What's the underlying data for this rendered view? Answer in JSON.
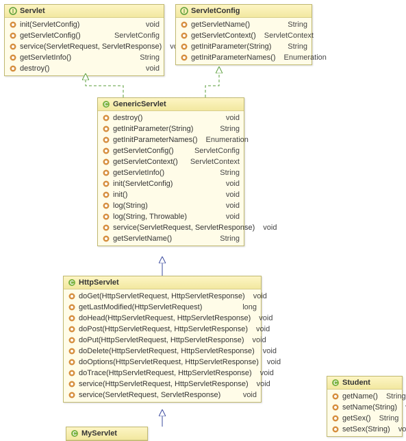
{
  "servlet": {
    "title": "Servlet",
    "rows": [
      {
        "n": "init(ServletConfig)",
        "r": "void"
      },
      {
        "n": "getServletConfig()",
        "r": "ServletConfig"
      },
      {
        "n": "service(ServletRequest, ServletResponse)",
        "r": "void"
      },
      {
        "n": "getServletInfo()",
        "r": "String"
      },
      {
        "n": "destroy()",
        "r": "void"
      }
    ]
  },
  "servletConfig": {
    "title": "ServletConfig",
    "rows": [
      {
        "n": "getServletName()",
        "r": "String"
      },
      {
        "n": "getServletContext()",
        "r": "ServletContext"
      },
      {
        "n": "getInitParameter(String)",
        "r": "String"
      },
      {
        "n": "getInitParameterNames()",
        "r": "Enumeration"
      }
    ]
  },
  "genericServlet": {
    "title": "GenericServlet",
    "rows": [
      {
        "n": "destroy()",
        "r": "void"
      },
      {
        "n": "getInitParameter(String)",
        "r": "String"
      },
      {
        "n": "getInitParameterNames()",
        "r": "Enumeration"
      },
      {
        "n": "getServletConfig()",
        "r": "ServletConfig"
      },
      {
        "n": "getServletContext()",
        "r": "ServletContext"
      },
      {
        "n": "getServletInfo()",
        "r": "String"
      },
      {
        "n": "init(ServletConfig)",
        "r": "void"
      },
      {
        "n": "init()",
        "r": "void"
      },
      {
        "n": "log(String)",
        "r": "void"
      },
      {
        "n": "log(String, Throwable)",
        "r": "void"
      },
      {
        "n": "service(ServletRequest, ServletResponse)",
        "r": "void"
      },
      {
        "n": "getServletName()",
        "r": "String"
      }
    ]
  },
  "httpServlet": {
    "title": "HttpServlet",
    "rows": [
      {
        "n": "doGet(HttpServletRequest, HttpServletResponse)",
        "r": "void"
      },
      {
        "n": "getLastModified(HttpServletRequest)",
        "r": "long"
      },
      {
        "n": "doHead(HttpServletRequest, HttpServletResponse)",
        "r": "void"
      },
      {
        "n": "doPost(HttpServletRequest, HttpServletResponse)",
        "r": "void"
      },
      {
        "n": "doPut(HttpServletRequest, HttpServletResponse)",
        "r": "void"
      },
      {
        "n": "doDelete(HttpServletRequest, HttpServletResponse)",
        "r": "void"
      },
      {
        "n": "doOptions(HttpServletRequest, HttpServletResponse)",
        "r": "void"
      },
      {
        "n": "doTrace(HttpServletRequest, HttpServletResponse)",
        "r": "void"
      },
      {
        "n": "service(HttpServletRequest, HttpServletResponse)",
        "r": "void"
      },
      {
        "n": "service(ServletRequest, ServletResponse)",
        "r": "void"
      }
    ]
  },
  "student": {
    "title": "Student",
    "rows": [
      {
        "n": "getName()",
        "r": "String"
      },
      {
        "n": "setName(String)",
        "r": "void"
      },
      {
        "n": "getSex()",
        "r": "String"
      },
      {
        "n": "setSex(String)",
        "r": "void"
      }
    ]
  },
  "myServlet": {
    "title": "MyServlet"
  }
}
